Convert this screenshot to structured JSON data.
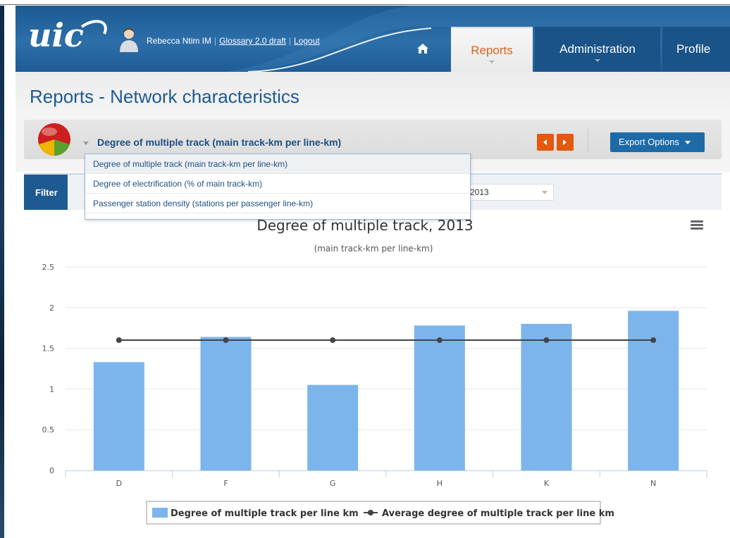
{
  "header": {
    "user_name": "Rebecca Ntim IM",
    "glossary_link": "Glossary 2.0 draft",
    "logout_link": "Logout",
    "tabs": [
      {
        "label": "Reports",
        "active": true
      },
      {
        "label": "Administration",
        "active": false
      },
      {
        "label": "Profile",
        "active": false
      }
    ]
  },
  "page": {
    "title": "Reports - Network characteristics"
  },
  "report_bar": {
    "selected_report": "Degree of multiple track (main track-km per line-km)",
    "export_label": "Export Options"
  },
  "dropdown": {
    "items": [
      "Degree of multiple track (main track-km per line-km)",
      "Degree of electrification (% of main track-km)",
      "Passenger station density (stations per passenger line-km)"
    ]
  },
  "filter": {
    "label": "Filter",
    "year": "2013"
  },
  "colors": {
    "bar": "#7cb5ec",
    "line": "#434348",
    "accent": "#e2590f",
    "brand": "#1e5a92"
  },
  "chart_data": {
    "type": "bar",
    "title": "Degree of multiple track, 2013",
    "subtitle": "(main track-km per line-km)",
    "categories": [
      "D",
      "F",
      "G",
      "H",
      "K",
      "N"
    ],
    "ylim": [
      0,
      2.5
    ],
    "yticks": [
      "0",
      "0.5",
      "1",
      "1.5",
      "2",
      "2.5"
    ],
    "series": [
      {
        "name": "Degree of multiple track per line km",
        "type": "bar",
        "values": [
          1.33,
          1.64,
          1.05,
          1.78,
          1.8,
          1.96
        ]
      },
      {
        "name": "Average degree of multiple track per line km",
        "type": "line",
        "values": [
          1.6,
          1.6,
          1.6,
          1.6,
          1.6,
          1.6
        ]
      }
    ],
    "legend_position": "bottom-center",
    "grid": true
  }
}
